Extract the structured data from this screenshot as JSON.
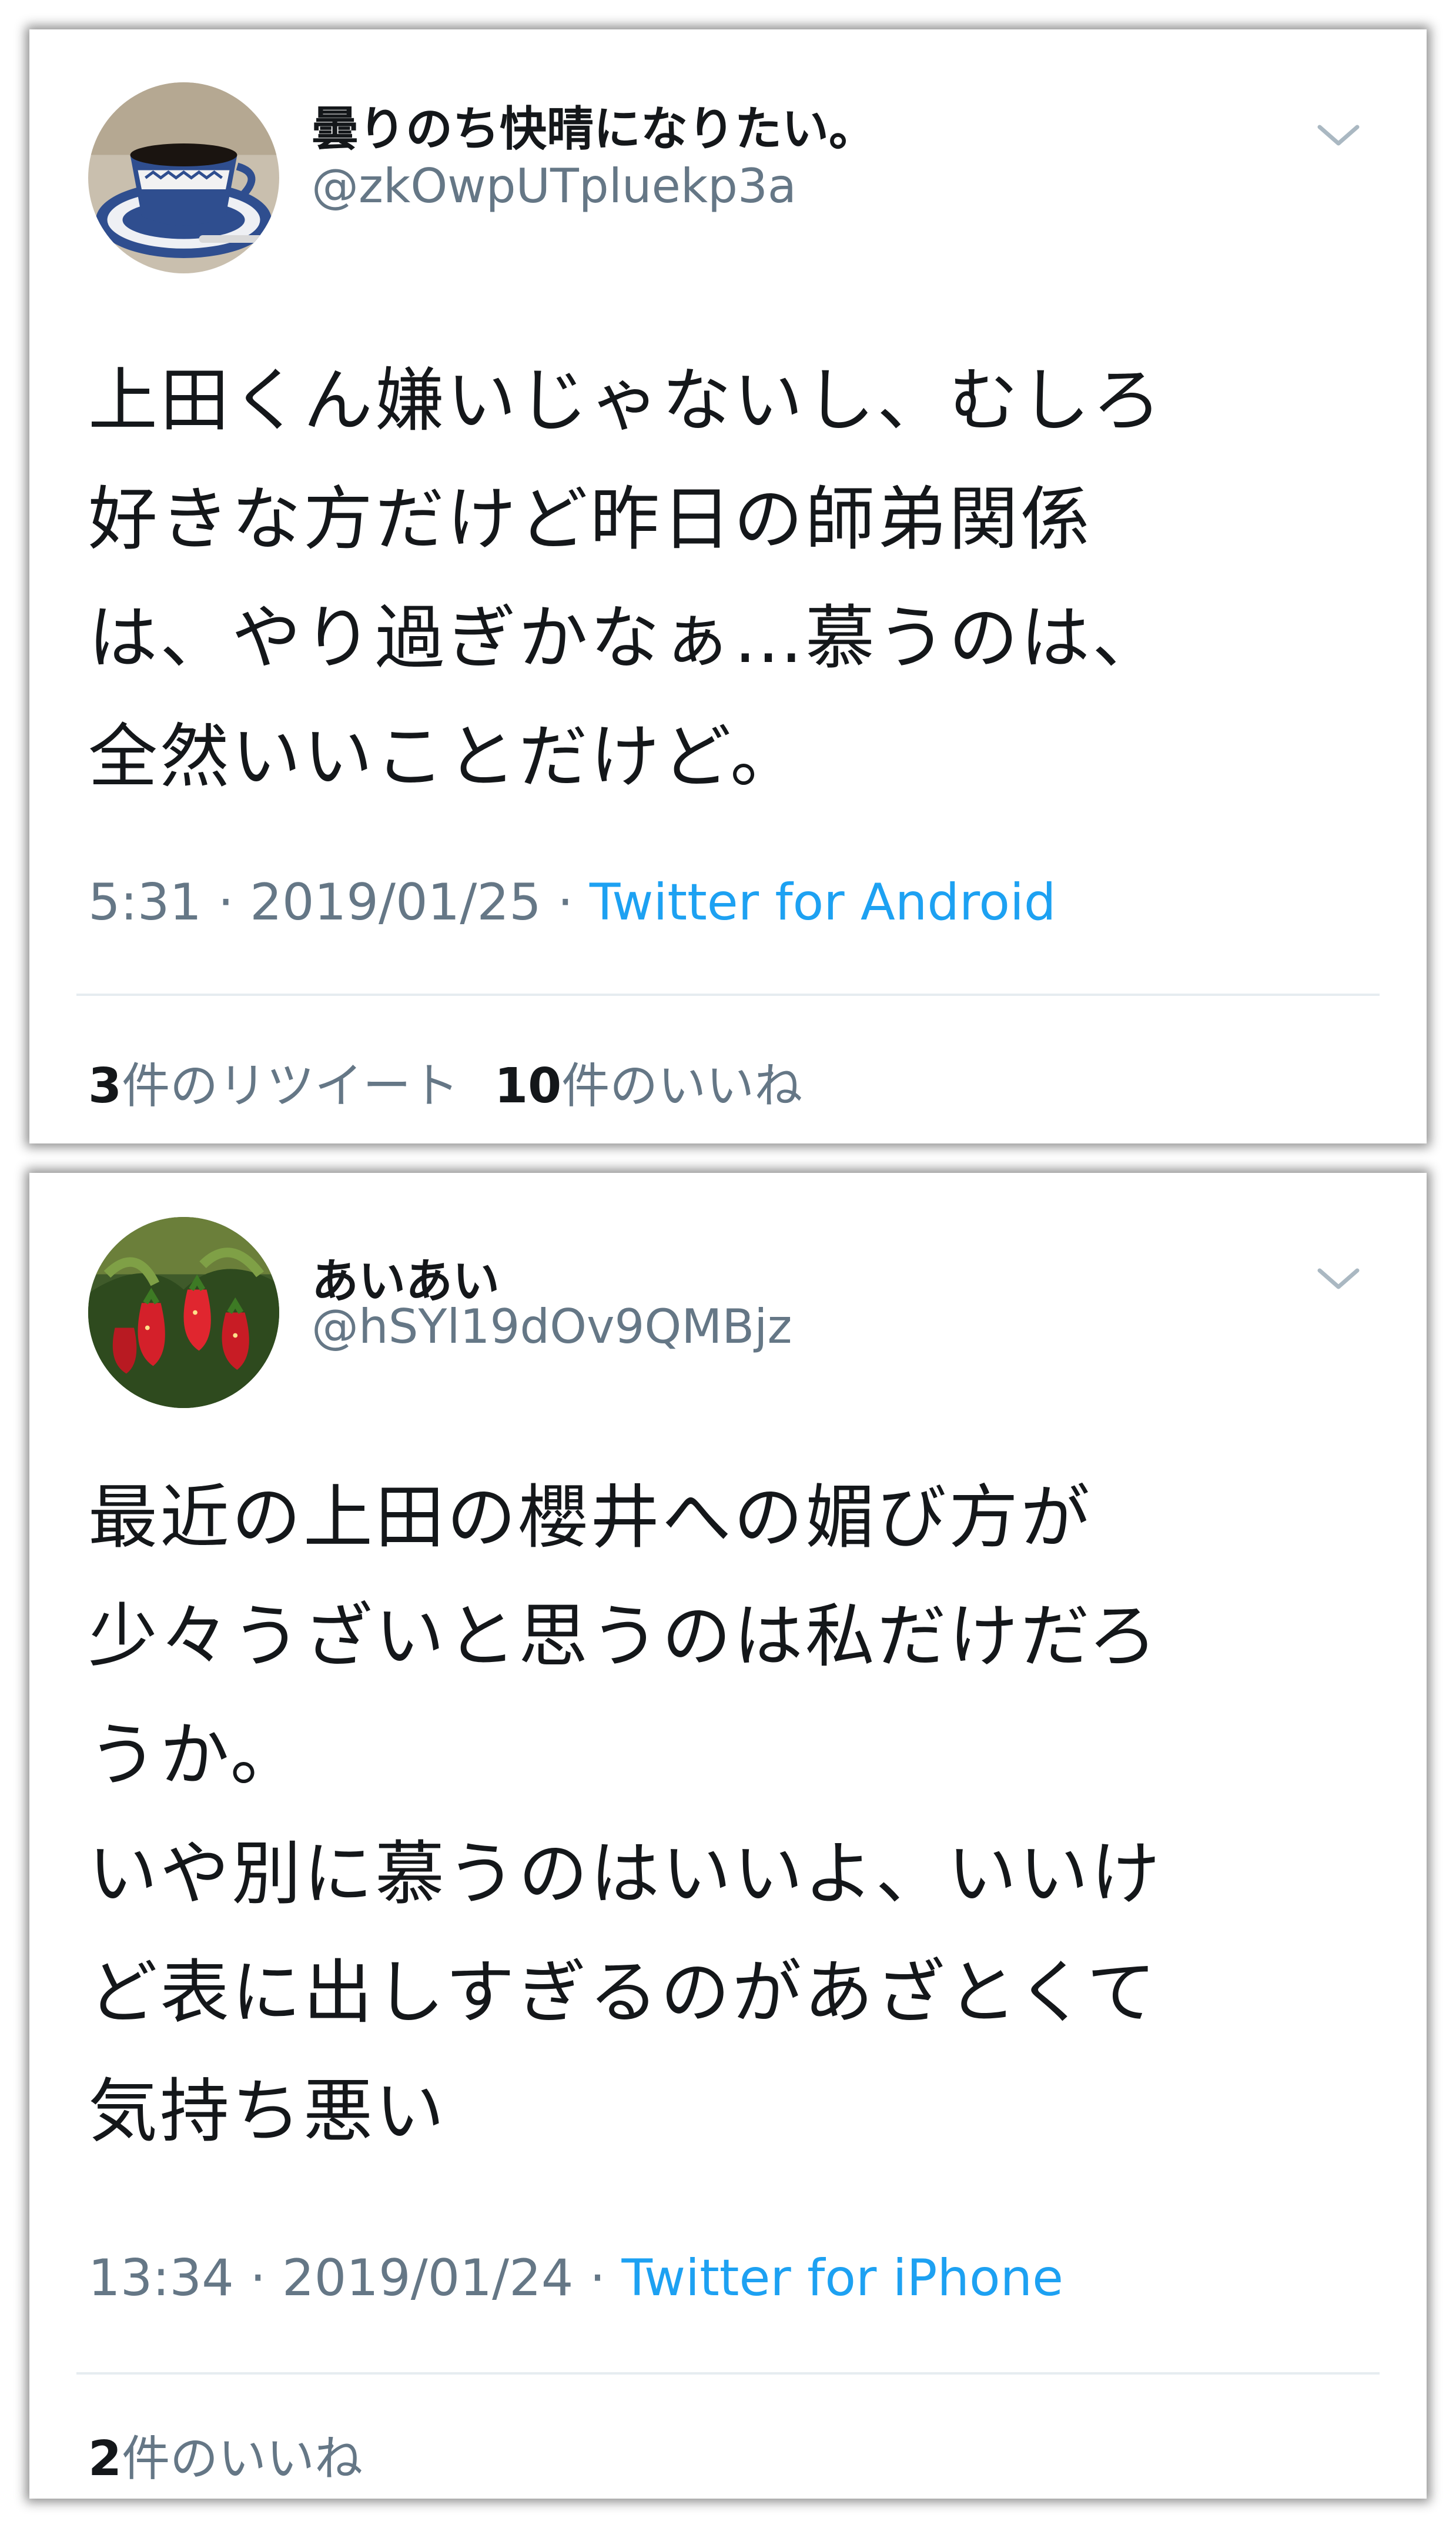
{
  "tweets": [
    {
      "display_name": "曇りのち快晴になりたい。",
      "handle": "@zkOwpUTpluekp3a",
      "body_lines": [
        "上田くん嫌いじゃないし、むしろ",
        "好きな方だけど昨日の師弟関係",
        "は、やり過ぎかなぁ…慕うのは、",
        "全然いいことだけど。"
      ],
      "time": "5:31 · 2019/01/25 · ",
      "source": "Twitter for Android",
      "retweet_count": "3",
      "retweet_label": "件のリツイート",
      "like_count": "10",
      "like_label": "件のいいね",
      "avatar": "coffee-cup-avatar"
    },
    {
      "display_name": "あいあい",
      "handle": "@hSYl19dOv9QMBjz",
      "body_lines": [
        "最近の上田の櫻井への媚び方が",
        "少々うざいと思うのは私だけだろ",
        "うか。",
        "いや別に慕うのはいいよ、いいけ",
        "ど表に出しすぎるのがあざとくて",
        "気持ち悪い"
      ],
      "time": "13:34 · 2019/01/24 · ",
      "source": "Twitter for iPhone",
      "like_count": "2",
      "like_label": "件のいいね",
      "avatar": "strawberry-avatar"
    }
  ],
  "colors": {
    "text": "#14171a",
    "secondary": "#657786",
    "link": "#1da1f2",
    "divider": "#e6ecf0"
  },
  "icons": {
    "menu": "chevron-down-icon"
  }
}
